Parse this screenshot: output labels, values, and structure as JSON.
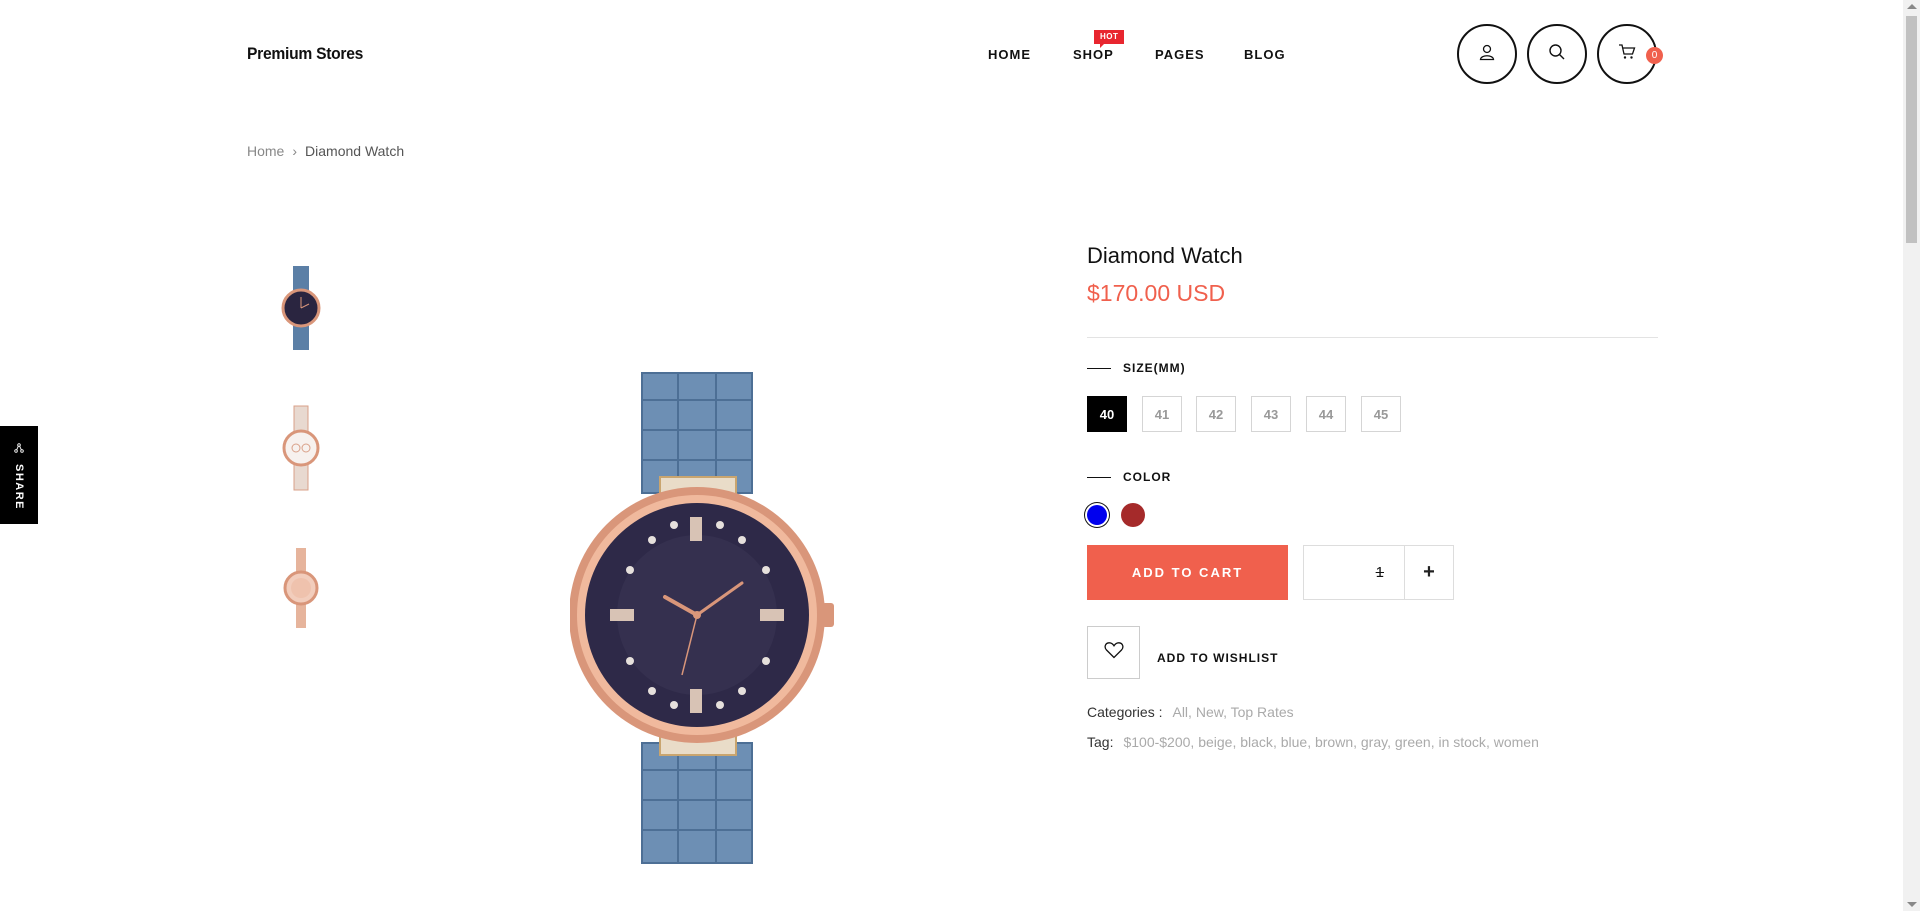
{
  "header": {
    "logo": "Premium Stores",
    "nav": [
      {
        "label": "HOME"
      },
      {
        "label": "SHOP",
        "badge": "HOT"
      },
      {
        "label": "PAGES"
      },
      {
        "label": "BLOG"
      }
    ],
    "cart_count": "0",
    "icons": [
      "user-icon",
      "search-icon",
      "cart-icon"
    ]
  },
  "breadcrumb": {
    "home": "Home",
    "separator": "›",
    "current": "Diamond Watch"
  },
  "share": {
    "label": "SHARE",
    "icon": "share-icon"
  },
  "product": {
    "title": "Diamond Watch",
    "price": "$170.00 USD",
    "size_label": "SIZE(MM)",
    "sizes": [
      "40",
      "41",
      "42",
      "43",
      "44",
      "45"
    ],
    "selected_size": "40",
    "color_label": "COLOR",
    "colors": [
      "#0000ee",
      "#a52a2a"
    ],
    "selected_color": "#0000ee",
    "add_to_cart": "ADD TO CART",
    "quantity": "1",
    "qty_plus": "+",
    "wishlist": "ADD TO WISHLIST",
    "categories_label": "Categories :",
    "categories": [
      "All",
      "New",
      "Top Rates"
    ],
    "tag_label": "Tag:",
    "tags": [
      "$100-$200",
      "beige",
      "black",
      "blue",
      "brown",
      "gray",
      "green",
      "in stock",
      "women"
    ]
  },
  "colors": {
    "accent": "#f0604d",
    "badge": "#e8262f"
  }
}
